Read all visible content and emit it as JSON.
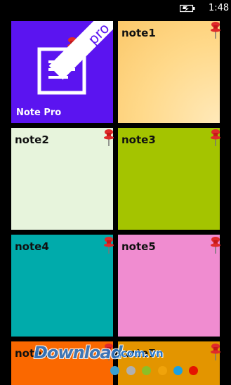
{
  "status_bar": {
    "time": "1:48",
    "battery_icon": "battery-charging-icon"
  },
  "pro_tile": {
    "label": "Note Pro",
    "ribbon": "pro",
    "color": "#5b14f0",
    "icon": "note-document-icon"
  },
  "notes": [
    {
      "title": "note1",
      "color": "#ffd98a"
    },
    {
      "title": "note2",
      "color": "#e7f4dc"
    },
    {
      "title": "note3",
      "color": "#a4c400"
    },
    {
      "title": "note4",
      "color": "#00abab"
    },
    {
      "title": "note5",
      "color": "#f08cd0"
    },
    {
      "title": "note6",
      "color": "#fa6800"
    },
    {
      "title": "note7",
      "color": "#e39500"
    }
  ],
  "color_dots": [
    "#3aa0d0",
    "#b0b0b0",
    "#8cbf26",
    "#f0a30a",
    "#1ba1e2",
    "#e51400"
  ],
  "watermark": {
    "brand": "Download",
    "domain": ".com.vn"
  }
}
